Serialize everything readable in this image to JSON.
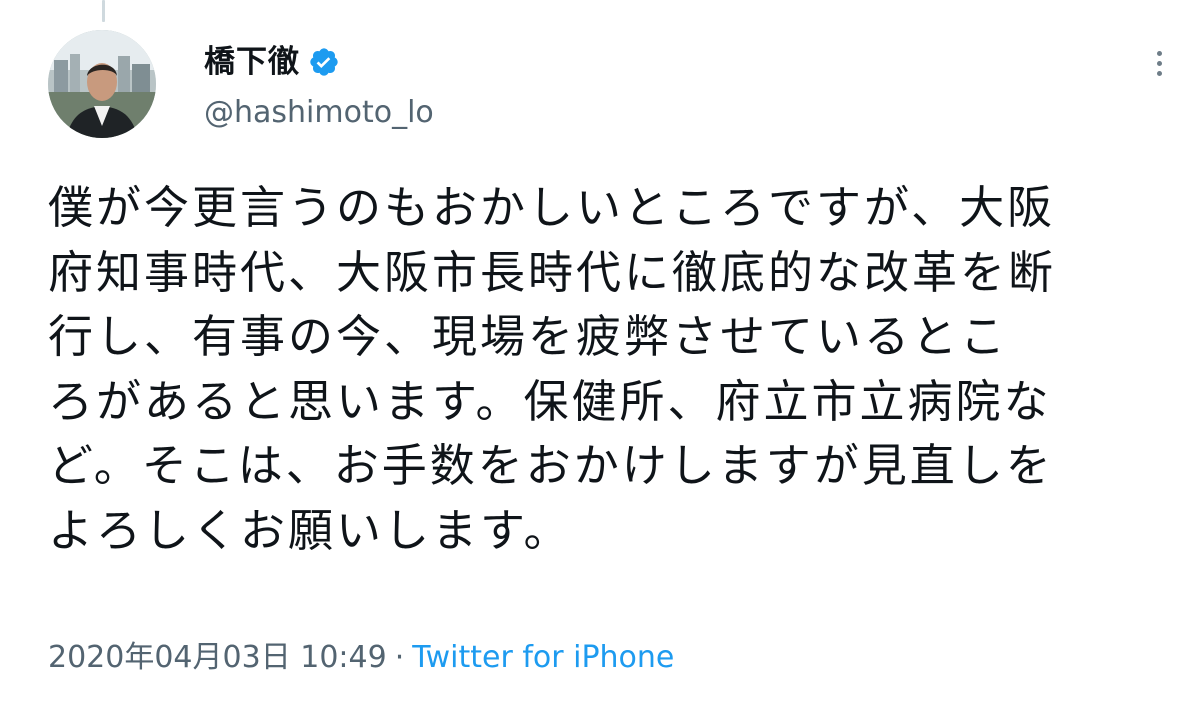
{
  "tweet": {
    "author": {
      "display_name": "橋下徹",
      "handle": "@hashimoto_lo",
      "verified": true,
      "verified_color": "#1d9bf0"
    },
    "text_lines": [
      "僕が今更言うのもおかしいところですが、大阪",
      "府知事時代、大阪市長時代に徹底的な改革を断",
      "行し、有事の今、現場を疲弊させているとこ",
      "ろがあると思います。保健所、府立市立病院な",
      "ど。そこは、お手数をおかけしますが見直しを",
      "よろしくお願いします。"
    ],
    "timestamp": "2020年04月03日 10:49",
    "separator": "·",
    "source": "Twitter for iPhone",
    "source_color": "#1d9bf0"
  },
  "icons": {
    "avatar": "profile-photo",
    "verified": "verified-badge-icon",
    "more": "more-options-icon"
  }
}
